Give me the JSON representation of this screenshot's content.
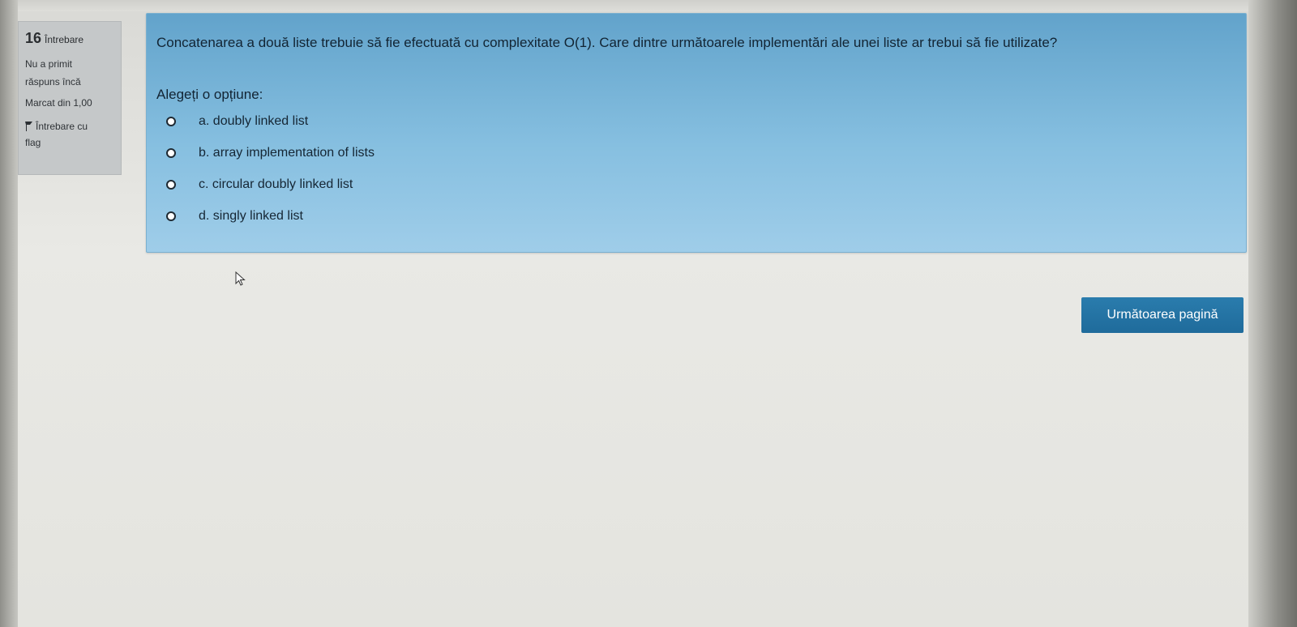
{
  "info": {
    "question_number": "16",
    "question_label": "Întrebare",
    "status_line1": "Nu a primit",
    "status_line2": "răspuns încă",
    "mark": "Marcat din 1,00",
    "flag_line1": "Întrebare cu",
    "flag_line2": "flag",
    "flag_icon": "flag-icon"
  },
  "question": {
    "text": "Concatenarea a două liste trebuie să fie efectuată cu complexitate O(1). Care dintre următoarele implementări ale unei liste ar trebui să fie utilizate?",
    "prompt": "Alegeți o opțiune:",
    "options": [
      {
        "label": "a. doubly linked list",
        "selected": false
      },
      {
        "label": "b. array implementation of lists",
        "selected": false
      },
      {
        "label": "c. circular doubly linked list",
        "selected": false
      },
      {
        "label": "d. singly linked list",
        "selected": false
      }
    ]
  },
  "navigation": {
    "next_label": "Următoarea pagină"
  },
  "colors": {
    "question_bg": "#7fb9dc",
    "info_bg": "#c5c8c9",
    "button_bg": "#1f6b9b"
  }
}
